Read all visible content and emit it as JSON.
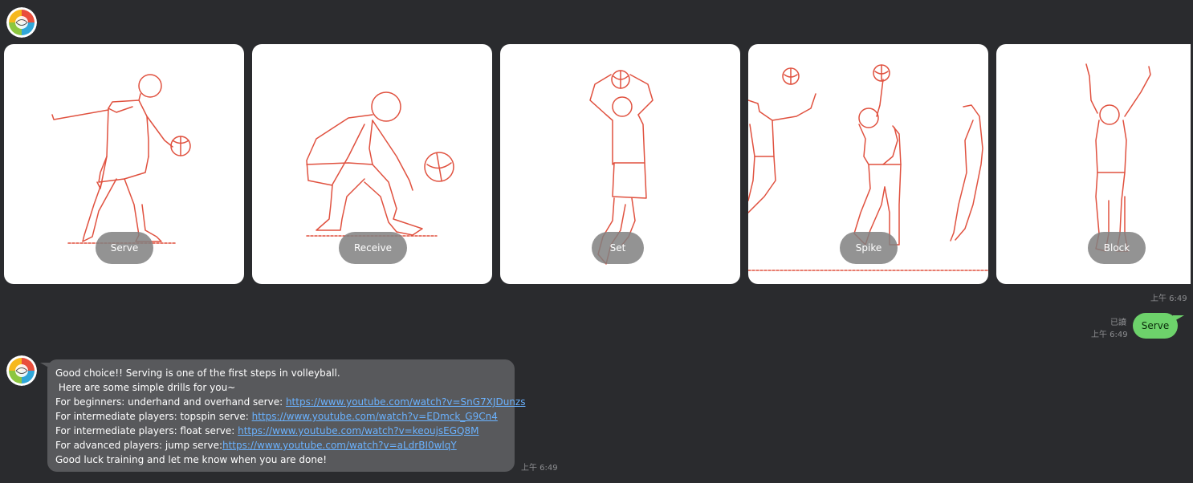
{
  "colors": {
    "background": "#2a2b2e",
    "card_background": "#ffffff",
    "illustration_stroke": "#e0513f",
    "user_bubble": "#6dd26b",
    "bot_bubble": "#58595c",
    "link": "#6ab2ff",
    "meta_text": "#8e8f92"
  },
  "bot": {
    "avatar_icon": "volleyball-logo-icon"
  },
  "carousel": {
    "items": [
      {
        "label": "Serve",
        "illustration": "serve-player-icon"
      },
      {
        "label": "Receive",
        "illustration": "receive-player-icon"
      },
      {
        "label": "Set",
        "illustration": "set-player-icon"
      },
      {
        "label": "Spike",
        "illustration": "spike-player-icon"
      },
      {
        "label": "Block",
        "illustration": "block-player-icon"
      }
    ],
    "time": "上午 6:49"
  },
  "user_message": {
    "text": "Serve",
    "read_status": "已讀",
    "time": "上午 6:49"
  },
  "bot_message": {
    "line1": "Good choice!! Serving is one of the first steps in volleyball.",
    "line2": " Here are some simple drills for you~",
    "line3_prefix": "For beginners: underhand and overhand serve: ",
    "line3_link": "https://www.youtube.com/watch?v=SnG7XJDunzs",
    "line4_prefix": "For intermediate players: topspin serve: ",
    "line4_link": "https://www.youtube.com/watch?v=EDmck_G9Cn4",
    "line5_prefix": "For intermediate players: float serve: ",
    "line5_link": "https://www.youtube.com/watch?v=keoujsEGQ8M",
    "line6_prefix": "For advanced players: jump serve:",
    "line6_link": "https://www.youtube.com/watch?v=aLdrBI0wlqY",
    "line7": "Good luck training and let me know when you are done!",
    "time": "上午 6:49"
  }
}
